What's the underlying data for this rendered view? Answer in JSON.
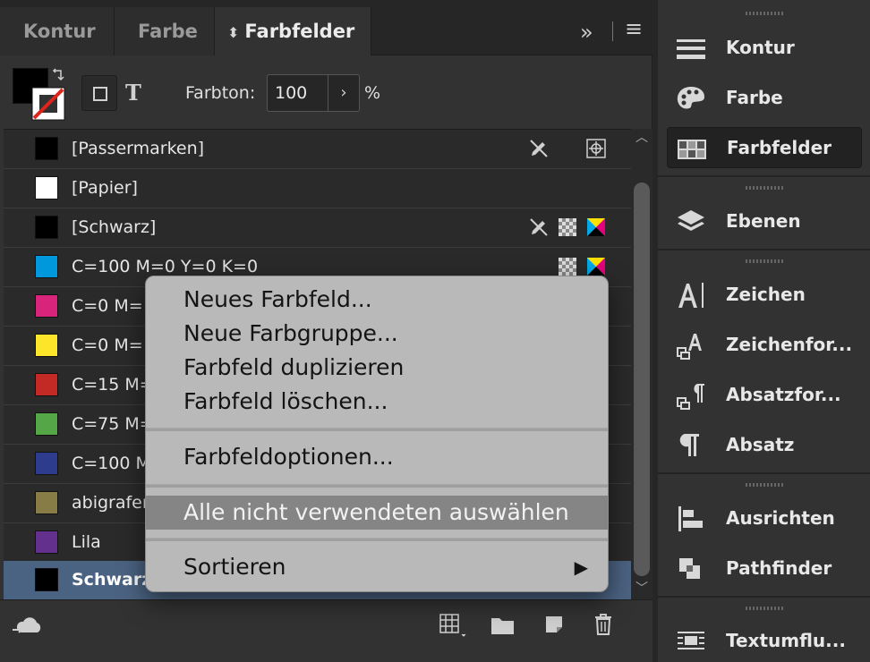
{
  "panel": {
    "tabs": [
      "Kontur",
      "Farbe",
      "Farbfelder"
    ],
    "active_tab": "Farbfelder",
    "collapse_glyph": "»",
    "menu_glyph": "≡"
  },
  "toolbar": {
    "tint_label": "Farbton:",
    "tint_value": "100",
    "stepper_glyph": "›",
    "percent": "%",
    "text_button": "T"
  },
  "swatches": [
    {
      "name": "[Passermarken]",
      "color": "#000000"
    },
    {
      "name": "[Papier]",
      "color": "#ffffff"
    },
    {
      "name": "[Schwarz]",
      "color": "#000000"
    },
    {
      "name": "C=100 M=0 Y=0 K=0",
      "color": "#0098dc"
    },
    {
      "name": "C=0 M=",
      "color": "#d9247b"
    },
    {
      "name": "C=0 M=",
      "color": "#fde52a"
    },
    {
      "name": "C=15 M=",
      "color": "#c32a25"
    },
    {
      "name": "C=75 M=",
      "color": "#55a646"
    },
    {
      "name": "C=100 M",
      "color": "#2e3c8e"
    },
    {
      "name": "abigrafen",
      "color": "#877c46"
    },
    {
      "name": "Lila",
      "color": "#63318d"
    },
    {
      "name": "Schwarz",
      "color": "#000000",
      "selected": true
    }
  ],
  "context_menu": {
    "items": [
      "Neues Farbfeld...",
      "Neue Farbgruppe...",
      "Farbfeld duplizieren",
      "Farbfeld löschen...",
      "Farbfeldoptionen...",
      "Alle nicht verwendeten auswählen",
      "Sortieren"
    ],
    "highlighted": "Alle nicht verwendeten auswählen",
    "submenu_arrow": "▶"
  },
  "side_panel": {
    "items": [
      {
        "label": "Kontur",
        "icon": "stroke-lines-icon"
      },
      {
        "label": "Farbe",
        "icon": "palette-icon"
      },
      {
        "label": "Farbfelder",
        "icon": "swatches-grid-icon",
        "active": true
      },
      {
        "label": "Ebenen",
        "icon": "layers-icon"
      },
      {
        "label": "Zeichen",
        "icon": "character-icon"
      },
      {
        "label": "Zeichenfor...",
        "icon": "character-styles-icon"
      },
      {
        "label": "Absatzfor...",
        "icon": "paragraph-styles-icon"
      },
      {
        "label": "Absatz",
        "icon": "paragraph-icon"
      },
      {
        "label": "Ausrichten",
        "icon": "align-icon"
      },
      {
        "label": "Pathfinder",
        "icon": "pathfinder-icon"
      },
      {
        "label": "Textumflu...",
        "icon": "text-wrap-icon"
      }
    ]
  },
  "colors": {
    "panel_bg": "#323232",
    "list_bg": "#2a2a2a",
    "selected_row": "#4b6382",
    "menu_bg": "#b9b9b9",
    "menu_highlight": "#858585"
  }
}
